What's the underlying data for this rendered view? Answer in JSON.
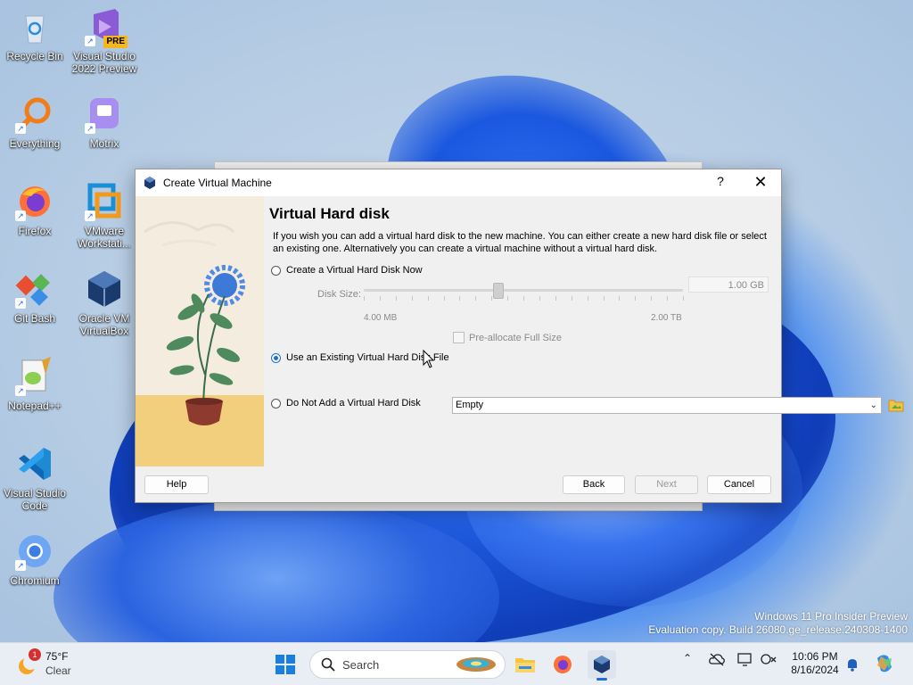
{
  "desktop": {
    "icons": [
      {
        "label": "Recycle Bin",
        "icon": "recycle-bin-icon"
      },
      {
        "label": "Visual Studio 2022 Preview",
        "icon": "visual-studio-preview-icon",
        "badge": "PRE"
      },
      {
        "label": "Everything",
        "icon": "everything-search-icon"
      },
      {
        "label": "Motrix",
        "icon": "motrix-icon"
      },
      {
        "label": "Firefox",
        "icon": "firefox-icon"
      },
      {
        "label": "VMware Workstati...",
        "icon": "vmware-icon"
      },
      {
        "label": "Git Bash",
        "icon": "git-bash-icon"
      },
      {
        "label": "Oracle VM VirtualBox",
        "icon": "virtualbox-icon"
      },
      {
        "label": "Notepad++",
        "icon": "notepadpp-icon"
      },
      {
        "label": "Visual Studio Code",
        "icon": "vscode-icon"
      },
      {
        "label": "Chromium",
        "icon": "chromium-icon"
      }
    ],
    "watermark": {
      "line1": "Windows 11 Pro Insider Preview",
      "line2": "Evaluation copy. Build 26080.ge_release.240308-1400"
    }
  },
  "dialog": {
    "title": "Create Virtual Machine",
    "help_glyph": "?",
    "close_glyph": "✕",
    "heading": "Virtual Hard disk",
    "description": "If you wish you can add a virtual hard disk to the new machine. You can either create a new hard disk file or select an existing one. Alternatively you can create a virtual machine without a virtual hard disk.",
    "options": {
      "create_now": "Create a Virtual Hard Disk Now",
      "use_existing": "Use an Existing Virtual Hard Disk File",
      "do_not_add": "Do Not Add a Virtual Hard Disk"
    },
    "selected_option": "use_existing",
    "disk_size": {
      "label": "Disk Size:",
      "value": "1.00 GB",
      "min_label": "4.00 MB",
      "max_label": "2.00 TB",
      "slider_fraction": 0.42
    },
    "preallocate": {
      "label": "Pre-allocate Full Size",
      "checked": false
    },
    "existing_file": {
      "selected": "Empty"
    },
    "buttons": {
      "help": "Help",
      "back": "Back",
      "next": "Next",
      "cancel": "Cancel"
    }
  },
  "taskbar": {
    "weather": {
      "temp": "75°F",
      "condition": "Clear",
      "alert": "1"
    },
    "search_placeholder": "Search",
    "clock": {
      "time": "10:06 PM",
      "date": "8/16/2024"
    }
  },
  "colors": {
    "accent": "#1e6fd1",
    "wallpaper_blue": "#1b55d8",
    "dialog_bg": "#f0f0f0"
  }
}
